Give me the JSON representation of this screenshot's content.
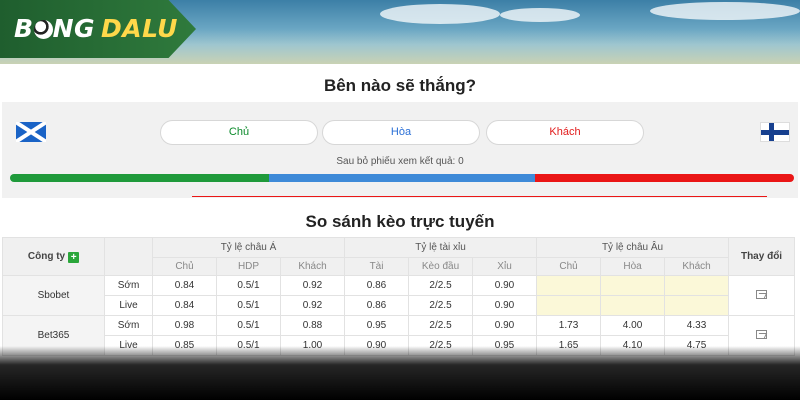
{
  "brand": {
    "part1": "B",
    "part2": "NG",
    "part3": "DALU"
  },
  "vote": {
    "title": "Bên nào sẽ thắng?",
    "home_label": "Chủ",
    "draw_label": "Hòa",
    "away_label": "Khách",
    "note": "Sau bỏ phiếu xem kết quả: 0",
    "bar_shares": [
      0.33,
      0.34,
      0.33
    ]
  },
  "comparison": {
    "title": "So sánh kèo trực tuyến",
    "company_header": "Công ty",
    "groups": [
      "Tỷ lệ châu Á",
      "Tỷ lệ tài xỉu",
      "Tỷ lệ châu Âu"
    ],
    "change_header": "Thay đổi",
    "subheaders": [
      "Chủ",
      "HDP",
      "Khách",
      "Tài",
      "Kèo đầu",
      "Xỉu",
      "Chủ",
      "Hòa",
      "Khách"
    ],
    "bookmakers": [
      {
        "name": "Sbobet",
        "rows": [
          {
            "type": "Sớm",
            "asia": [
              "0.84",
              "0.5/1",
              "0.92"
            ],
            "ou": [
              "0.86",
              "2/2.5",
              "0.90"
            ],
            "eu": [
              "",
              "",
              ""
            ]
          },
          {
            "type": "Live",
            "asia": [
              "0.84",
              "0.5/1",
              "0.92"
            ],
            "ou": [
              "0.86",
              "2/2.5",
              "0.90"
            ],
            "eu": [
              "",
              "",
              ""
            ]
          }
        ]
      },
      {
        "name": "Bet365",
        "rows": [
          {
            "type": "Sớm",
            "asia": [
              "0.98",
              "0.5/1",
              "0.88"
            ],
            "ou": [
              "0.95",
              "2/2.5",
              "0.90"
            ],
            "eu": [
              "1.73",
              "4.00",
              "4.33"
            ]
          },
          {
            "type": "Live",
            "asia": [
              "0.85",
              "0.5/1",
              "1.00"
            ],
            "ou": [
              "0.90",
              "2/2.5",
              "0.95"
            ],
            "eu": [
              "1.65",
              "4.10",
              "4.75"
            ]
          }
        ]
      }
    ]
  }
}
